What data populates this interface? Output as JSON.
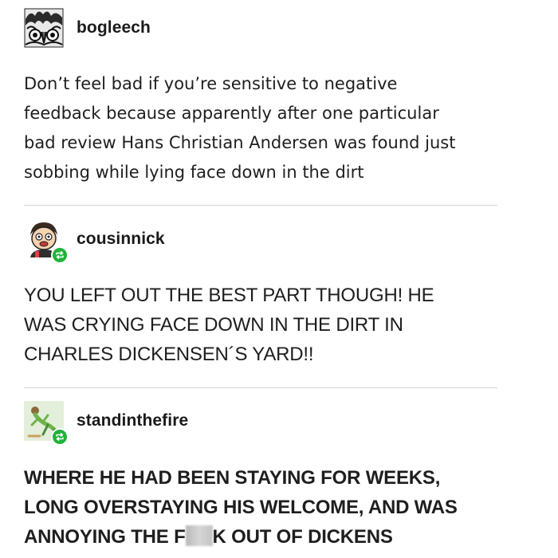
{
  "posts": [
    {
      "username": "bogleech",
      "avatar_icon": "monster-face-icon",
      "reblog": false,
      "lines": [
        "Don’t feel bad if you’re sensitive to negative",
        "feedback because apparently after one particular",
        "bad review Hans Christian Andersen was found just",
        "sobbing while lying face down in the dirt"
      ]
    },
    {
      "username": "cousinnick",
      "avatar_icon": "cartoon-person-icon",
      "reblog": true,
      "lines": [
        "YOU LEFT OUT THE BEST PART THOUGH! HE",
        "WAS CRYING FACE DOWN IN THE DIRT IN",
        "CHARLES DICKENSEN´S YARD!!"
      ]
    },
    {
      "username": "standinthefire",
      "avatar_icon": "green-figure-icon",
      "reblog": true,
      "lines": [
        "WHERE HE HAD BEEN STAYING FOR WEEKS,",
        "LONG OVERSTAYING HIS WELCOME, AND WAS"
      ],
      "last_line_before": "ANNOYING THE F",
      "last_line_after": "K OUT OF DICKENS"
    }
  ],
  "colors": {
    "reblog_badge": "#1fb33a",
    "divider": "#d4d4d4",
    "text": "#1e1e1e"
  }
}
